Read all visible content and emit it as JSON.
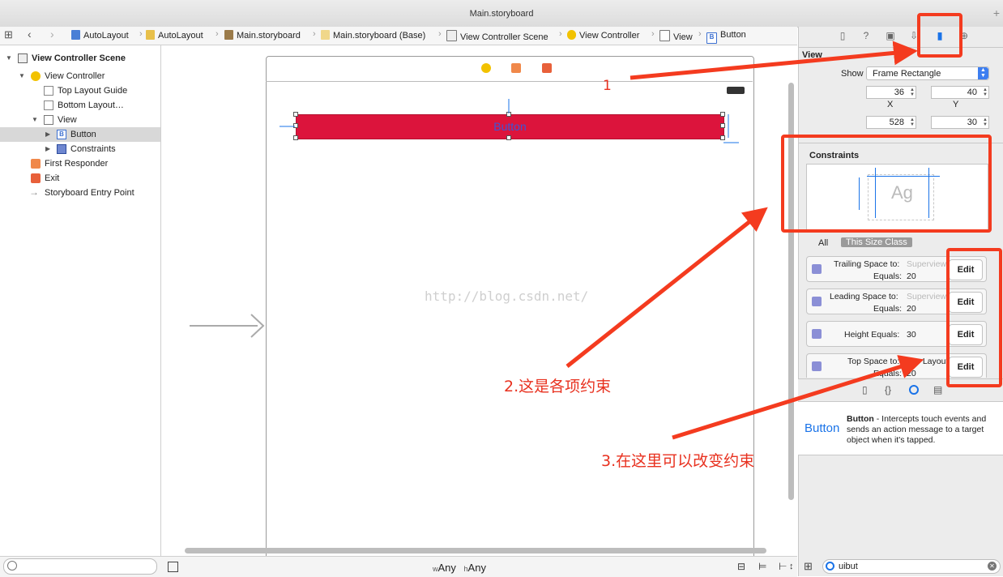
{
  "window": {
    "title": "Main.storyboard"
  },
  "jumpbar": {
    "items": [
      "AutoLayout",
      "AutoLayout",
      "Main.storyboard",
      "Main.storyboard (Base)",
      "View Controller Scene",
      "View Controller",
      "View",
      "Button"
    ]
  },
  "navigator": {
    "scene_title": "View Controller Scene",
    "items": [
      "View Controller",
      "Top Layout Guide",
      "Bottom Layout…",
      "View",
      "Button",
      "Constraints",
      "First Responder",
      "Exit",
      "Storyboard Entry Point"
    ]
  },
  "canvas": {
    "button_label": "Button",
    "watermark": "http://blog.csdn.net/",
    "size_class_w": "w",
    "size_class_w_value": "Any",
    "size_class_h": "h",
    "size_class_h_value": "Any"
  },
  "inspector": {
    "section_view": "View",
    "show_label": "Show",
    "show_value": "Frame Rectangle",
    "x_value": "36",
    "y_value": "40",
    "x_label": "X",
    "y_label": "Y",
    "width_value": "528",
    "height_value": "30",
    "constraints_title": "Constraints",
    "preview_text": "Ag",
    "scope_all": "All",
    "scope_size_class": "This Size Class",
    "constraints": [
      {
        "line1": "Trailing Space to:",
        "target": "Superview",
        "line2": "Equals:",
        "value": "20",
        "edit": "Edit"
      },
      {
        "line1": "Leading Space to:",
        "target": "Superview",
        "line2": "Equals:",
        "value": "20",
        "edit": "Edit"
      },
      {
        "line1": "Height Equals:",
        "target": "",
        "line2": "",
        "value": "30",
        "edit": "Edit"
      },
      {
        "line1": "Top Space to:",
        "target": "Top Layout",
        "line2": "Equals:",
        "value": "20",
        "edit": "Edit"
      }
    ],
    "library_item_name": "Button",
    "library_item_title": "Button",
    "library_item_desc": " - Intercepts touch events and sends an action message to a target object when it's tapped.",
    "library_filter": "uibut"
  },
  "annotations": {
    "note1": "1",
    "note2": "2.这是各项约束",
    "note3": "3.在这里可以改变约束"
  },
  "colors": {
    "annotation_red": "#e8311f",
    "button_fill": "#dc143c",
    "accent_blue": "#1a73e8"
  }
}
